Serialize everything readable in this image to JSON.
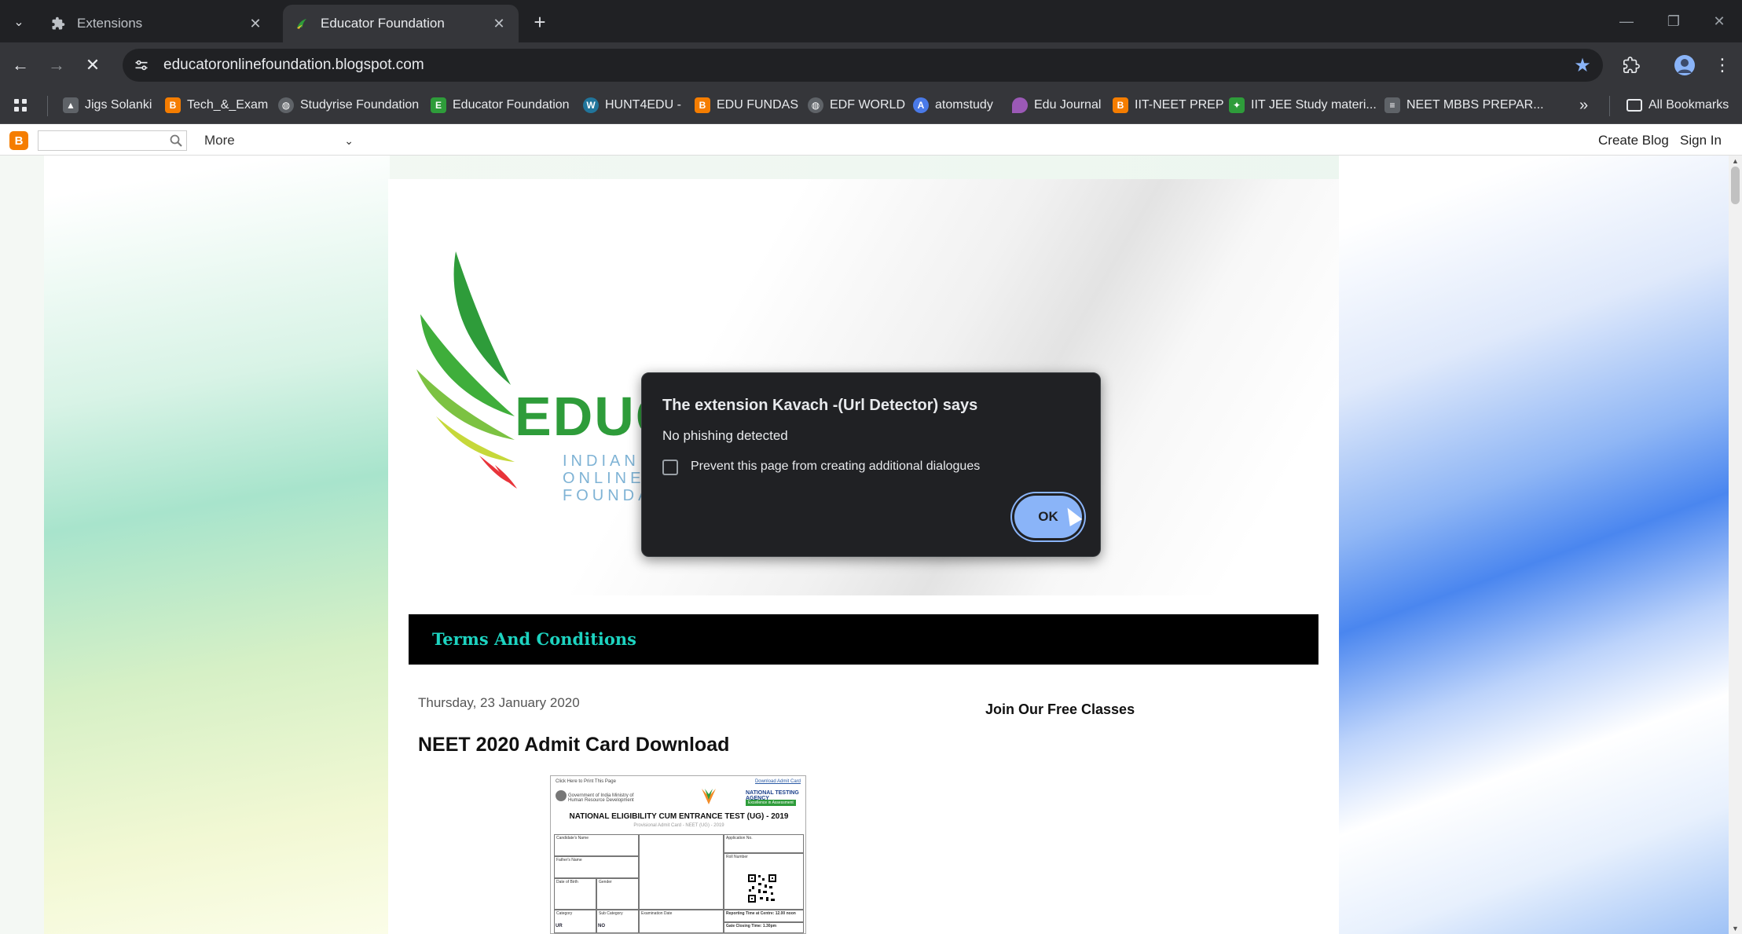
{
  "browser": {
    "tabs": [
      {
        "title": "Extensions",
        "icon": "puzzle-icon",
        "active": false
      },
      {
        "title": "Educator Foundation",
        "icon": "site-favicon",
        "active": true
      }
    ],
    "url": "educatoronlinefoundation.blogspot.com",
    "accent_color": "#8ab4f8"
  },
  "bookmarks": {
    "items": [
      {
        "label": "Jigs Solanki",
        "icon": "image-icon",
        "color": "#5f6368"
      },
      {
        "label": "Tech_&_Exam",
        "icon": "blogger-icon",
        "color": "#f57d00"
      },
      {
        "label": "Studyrise Foundation",
        "icon": "globe-icon",
        "color": "#5f6368"
      },
      {
        "label": "Educator Foundation",
        "icon": "edf-icon",
        "color": "#2e9c3a"
      },
      {
        "label": "HUNT4EDU -",
        "icon": "wordpress-icon",
        "color": "#21759b"
      },
      {
        "label": "EDU FUNDAS",
        "icon": "blogger-icon",
        "color": "#f57d00"
      },
      {
        "label": "EDF WORLD",
        "icon": "globe-icon",
        "color": "#5f6368"
      },
      {
        "label": "atomstudy",
        "icon": "atom-icon",
        "color": "#4a7ae8"
      },
      {
        "label": "Edu Journal",
        "icon": "pin-icon",
        "color": "#9b59b6"
      },
      {
        "label": "IIT-NEET PREP",
        "icon": "blogger-icon",
        "color": "#f57d00"
      },
      {
        "label": "IIT JEE Study materi...",
        "icon": "leaf-icon",
        "color": "#2e9c3a"
      },
      {
        "label": "NEET MBBS PREPAR...",
        "icon": "doc-icon",
        "color": "#5f6368"
      }
    ],
    "overflow": "»",
    "all_bookmarks": "All Bookmarks"
  },
  "blogger_nav": {
    "more": "More",
    "create_blog": "Create Blog",
    "sign_in": "Sign In"
  },
  "page": {
    "logo_text": "EDUC",
    "logo_sub": [
      "INDIAN",
      "ONLINE",
      "FOUNDA"
    ],
    "terms_bar": "Terms And Conditions",
    "post_date": "Thursday, 23 January 2020",
    "post_title": "NEET 2020 Admit Card Download",
    "sidebar_title": "Join Our Free Classes",
    "admit_card": {
      "print_text": "Click Here to Print This Page",
      "download_link": "Download Admit Card",
      "ministry": "Government of India Ministry of Human Resource Development",
      "agency": "NATIONAL TESTING AGENCY",
      "agency_sub": "Excellence in Assessment",
      "title": "NATIONAL ELIGIBILITY CUM ENTRANCE TEST (UG) - 2019",
      "subtitle": "Provisional Admit Card - NEET (UG) - 2019",
      "fields": [
        "Candidate's Name",
        "Father's Name",
        "Date of Birth",
        "Gender",
        "Category",
        "Sub Category",
        "Application No.",
        "Roll Number",
        "Examination Date",
        "Reporting Time at Centre: 12.00 noon",
        "Gate Closing Time: 1.30pm"
      ],
      "values": [
        "UR",
        "NO"
      ]
    }
  },
  "dialog": {
    "title": "The extension Kavach -(Url Detector) says",
    "message": "No phishing detected",
    "checkbox_label": "Prevent this page from creating additional dialogues",
    "checkbox_checked": false,
    "ok_label": "OK"
  }
}
